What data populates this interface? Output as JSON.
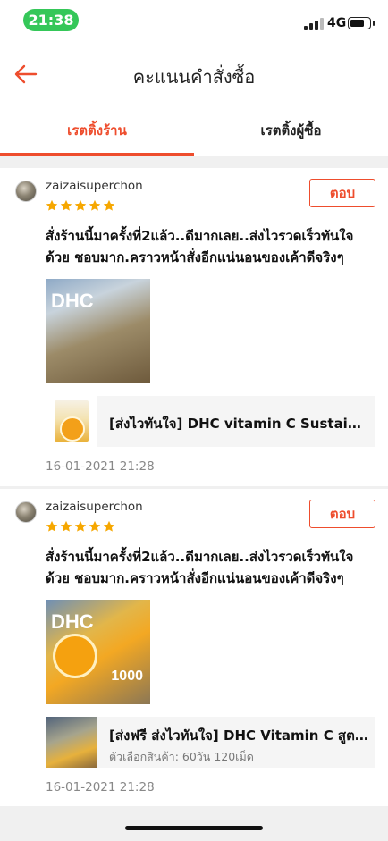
{
  "status_bar": {
    "time": "21:38",
    "network": "4G"
  },
  "header": {
    "title": "คะแนนคำสั่งซื้อ"
  },
  "tabs": [
    {
      "label": "เรตติ้งร้าน",
      "active": true
    },
    {
      "label": "เรตติ้งผู้ซื้อ",
      "active": false
    }
  ],
  "colors": {
    "accent": "#ee4d2d",
    "star": "#f6a700",
    "status_pill": "#35c759"
  },
  "reviews": [
    {
      "username": "zaizaisuperchon",
      "rating": 5,
      "reply_label": "ตอบ",
      "comment": "สั่งร้านนี้มาครั้งที่2แล้ว..ดีมากเลย..ส่งไวรวดเร็วทันใจด้วย ชอบมาก.คราวหน้าสั่งอีกแน่นอนของเค้าดีจริงๆ",
      "photo_label": "DHC",
      "product_name": "[ส่งไวทันใจ] DHC vitamin C Sustain...",
      "product_variant": "",
      "date": "16-01-2021 21:28"
    },
    {
      "username": "zaizaisuperchon",
      "rating": 5,
      "reply_label": "ตอบ",
      "comment": "สั่งร้านนี้มาครั้งที่2แล้ว..ดีมากเลย..ส่งไวรวดเร็วทันใจด้วย ชอบมาก.คราวหน้าสั่งอีกแน่นอนของเค้าดีจริงๆ",
      "photo_label": "DHC",
      "photo_sub": "1000",
      "product_name": "[ส่งฟรี ส่งไวทันใจ] DHC Vitamin C สูต...",
      "product_variant": "ตัวเลือกสินค้า: 60วัน 120เม็ด",
      "date": "16-01-2021 21:28"
    }
  ]
}
